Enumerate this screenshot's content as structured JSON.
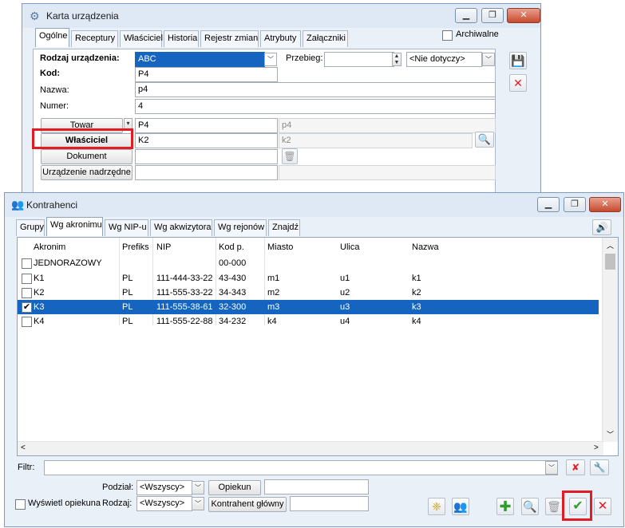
{
  "card": {
    "title": "Karta urządzenia",
    "archive_label": "Archiwalne",
    "tabs": [
      "Ogólne",
      "Receptury",
      "Właściciel",
      "Historia",
      "Rejestr zmian",
      "Atrybuty",
      "Załączniki"
    ],
    "device_type_label": "Rodzaj urządzenia:",
    "device_type_value": "ABC",
    "mileage_label": "Przebieg:",
    "mileage_value": "",
    "mileage_unit": "<Nie dotyczy>",
    "code_label": "Kod:",
    "code_value": "P4",
    "name_label": "Nazwa:",
    "name_value": "p4",
    "number_label": "Numer:",
    "number_value": "4",
    "goods_button": "Towar",
    "goods_code": "P4",
    "goods_name": "p4",
    "owner_button": "Właściciel",
    "owner_code": "K2",
    "owner_name": "k2",
    "document_button": "Dokument",
    "document_value": "",
    "parent_button": "Urządzenie nadrzędne",
    "parent_code": "",
    "parent_name": ""
  },
  "contractors": {
    "title": "Kontrahenci",
    "tabs": [
      "Grupy",
      "Wg akronimu",
      "Wg NIP-u",
      "Wg akwizytora",
      "Wg rejonów",
      "Znajdź"
    ],
    "columns": [
      "Akronim",
      "Prefiks",
      "NIP",
      "Kod p.",
      "Miasto",
      "Ulica",
      "Nazwa"
    ],
    "rows": [
      {
        "akronim": "JEDNORAZOWY",
        "prefiks": "",
        "nip": "",
        "kod": "00-000",
        "miasto": "",
        "ulica": "",
        "nazwa": ""
      },
      {
        "akronim": "K1",
        "prefiks": "PL",
        "nip": "111-444-33-22",
        "kod": "43-430",
        "miasto": "m1",
        "ulica": "u1",
        "nazwa": "k1"
      },
      {
        "akronim": "K2",
        "prefiks": "PL",
        "nip": "111-555-33-22",
        "kod": "34-343",
        "miasto": "m2",
        "ulica": "u2",
        "nazwa": "k2"
      },
      {
        "akronim": "K3",
        "prefiks": "PL",
        "nip": "111-555-38-61",
        "kod": "32-300",
        "miasto": "m3",
        "ulica": "u3",
        "nazwa": "k3"
      },
      {
        "akronim": "K4",
        "prefiks": "PL",
        "nip": "111-555-22-88",
        "kod": "34-232",
        "miasto": "k4",
        "ulica": "u4",
        "nazwa": "k4"
      }
    ],
    "filter_label": "Filtr:",
    "filter_value": "",
    "split_label": "Podział:",
    "split_value": "<Wszyscy>",
    "kind_label": "Rodzaj:",
    "kind_value": "<Wszyscy>",
    "guardian_button": "Opiekun",
    "guardian_value": "",
    "main_contractor_button": "Kontrahent główny",
    "main_contractor_value": "",
    "show_guardian_label": "Wyświetl opiekuna"
  },
  "colors": {
    "selection": "#1565c0",
    "highlight_frame": "#e31b23",
    "close_button": "#c74a2e"
  }
}
